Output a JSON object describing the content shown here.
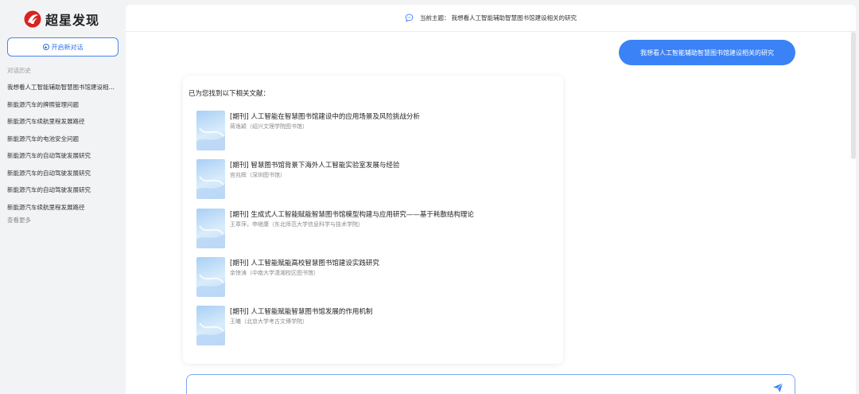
{
  "app": {
    "logo_text": "超星发现",
    "brand_color": "#d6241f",
    "accent": "#3b82f6"
  },
  "sidebar": {
    "new_chat_label": "开启新对话",
    "history_title": "对话历史",
    "items": [
      {
        "label": "我想看人工智能辅助智慧图书馆建设相关的研究"
      },
      {
        "label": "新能源汽车的牌照管理问题"
      },
      {
        "label": "新能源汽车续航里程发展路径"
      },
      {
        "label": "新能源汽车的电池安全问题"
      },
      {
        "label": "新能源汽车的自动驾驶发展研究"
      },
      {
        "label": "新能源汽车的自动驾驶发展研究"
      },
      {
        "label": "新能源汽车的自动驾驶发展研究"
      },
      {
        "label": "新能源汽车续航里程发展路径"
      }
    ],
    "see_more_label": "查看更多"
  },
  "header": {
    "topic_label": "当前主题：",
    "topic": "我想看人工智能辅助智慧图书馆建设相关的研究"
  },
  "conversation": {
    "user_message": "我想看人工智能辅助智慧图书馆建设相关的研究",
    "reply_intro": "已为您找到以下相关文献：",
    "references": [
      {
        "type": "[期刊]",
        "title": "人工智能在智慧图书馆建设中的应用场景及风险挑战分析",
        "author": "蒋逸颖（绍兴文理学院图书馆）"
      },
      {
        "type": "[期刊]",
        "title": "智慧图书馆背景下海外人工智能实验室发展与经验",
        "author": "宫兆辉（深圳图书馆）"
      },
      {
        "type": "[期刊]",
        "title": "生成式人工智能赋能智慧图书馆模型构建与应用研究——基于耗散结构理论",
        "author": "王章萍，申继康（东北师范大学信息科学与技术学院）"
      },
      {
        "type": "[期刊]",
        "title": "人工智能赋能高校智慧图书馆建设实践研究",
        "author": "余惊涛（中南大学潇湘校区图书馆）"
      },
      {
        "type": "[期刊]",
        "title": "人工智能赋能智慧图书馆发展的作用机制",
        "author": "王曦（北京大学考古文博学院）"
      }
    ]
  },
  "input": {
    "placeholder": "",
    "value": ""
  }
}
